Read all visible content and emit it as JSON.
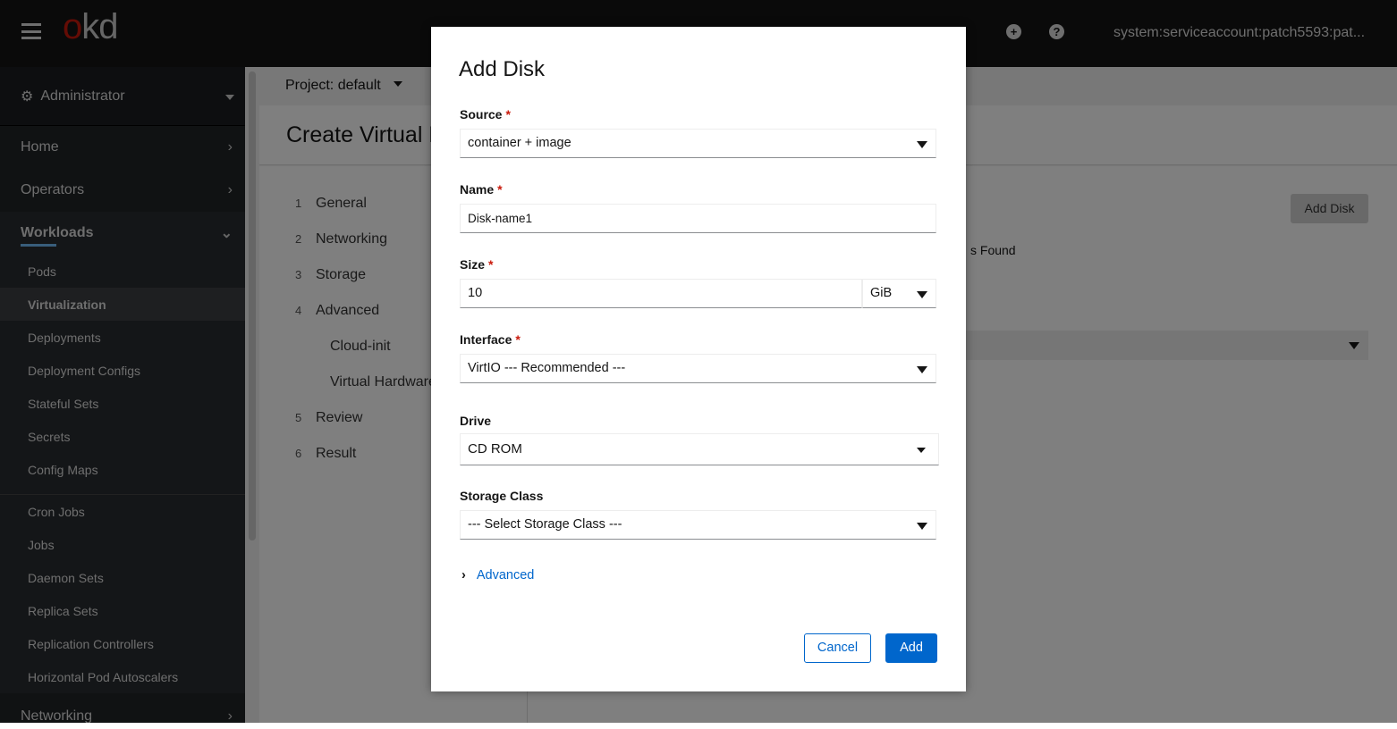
{
  "masthead": {
    "logo": "okd",
    "logo_o": "o",
    "logo_rest": "kd",
    "user": "system:serviceaccount:patch5593:pat...",
    "icons": [
      "plus-circle-icon",
      "question-circle-icon"
    ]
  },
  "sidebar": {
    "perspective": "Administrator",
    "items": [
      {
        "label": "Home"
      },
      {
        "label": "Operators"
      },
      {
        "label": "Workloads"
      },
      {
        "label": "Networking"
      }
    ],
    "workloads": [
      "Pods",
      "Virtualization",
      "Deployments",
      "Deployment Configs",
      "Stateful Sets",
      "Secrets",
      "Config Maps",
      "Cron Jobs",
      "Jobs",
      "Daemon Sets",
      "Replica Sets",
      "Replication Controllers",
      "Horizontal Pod Autoscalers"
    ],
    "active": "Virtualization"
  },
  "page": {
    "project": "Project: default",
    "title": "Create Virtual M",
    "add_disk": "Add Disk",
    "found": "s Found",
    "steps": [
      {
        "n": "1",
        "label": "General"
      },
      {
        "n": "2",
        "label": "Networking"
      },
      {
        "n": "3",
        "label": "Storage"
      },
      {
        "n": "4",
        "label": "Advanced"
      },
      {
        "n": "",
        "label": "Cloud-init"
      },
      {
        "n": "",
        "label": "Virtual Hardware"
      },
      {
        "n": "5",
        "label": "Review"
      },
      {
        "n": "6",
        "label": "Result"
      }
    ]
  },
  "modal": {
    "title": "Add Disk",
    "source": {
      "label": "Source",
      "value": "container + image"
    },
    "name": {
      "label": "Name",
      "value": "Disk-name1"
    },
    "size": {
      "label": "Size",
      "value": "10",
      "unit": "GiB"
    },
    "interface": {
      "label": "Interface",
      "value": "VirtIO --- Recommended ---"
    },
    "drive": {
      "label": "Drive",
      "value": "CD ROM"
    },
    "storage_class": {
      "label": "Storage Class",
      "value": "--- Select Storage Class ---"
    },
    "advanced": "Advanced",
    "cancel": "Cancel",
    "add": "Add",
    "required_mark": "*"
  }
}
